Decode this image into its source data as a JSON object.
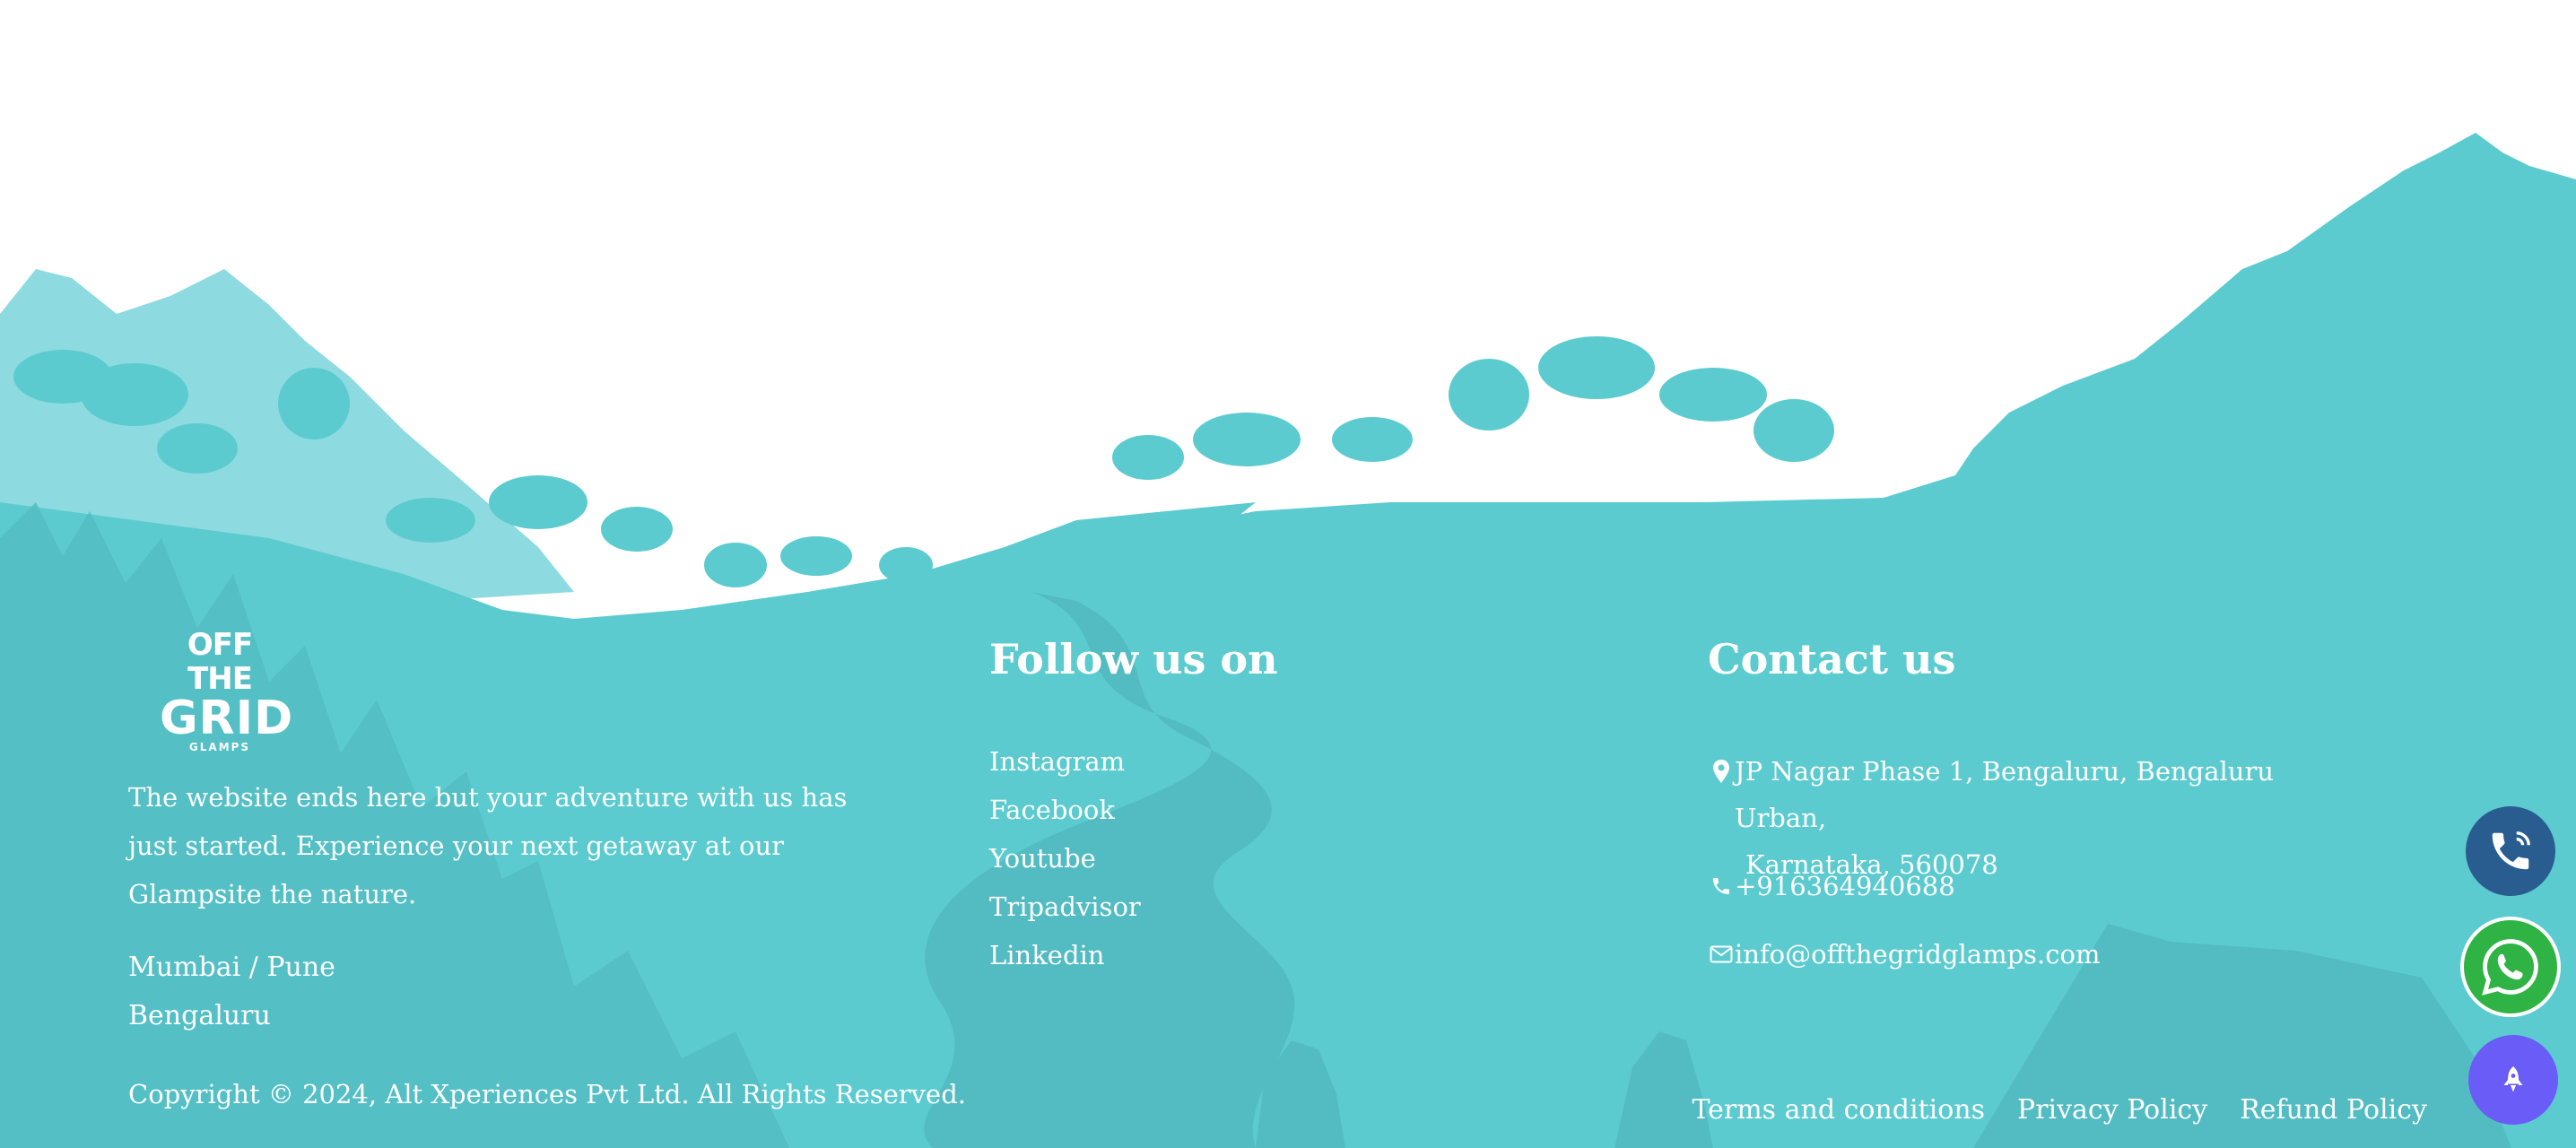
{
  "brand": {
    "logo_line1": "OFF THE",
    "logo_line2": "GRID",
    "logo_line3": "GLAMPS"
  },
  "about": {
    "text": "The website ends here but your adventure with us has just started. Experience your next getaway at our Glampsite the nature."
  },
  "locations": [
    "Mumbai / Pune",
    "Bengaluru"
  ],
  "follow": {
    "title": "Follow us on",
    "links": [
      "Instagram",
      "Facebook",
      "Youtube",
      "Tripadvisor",
      "Linkedin"
    ]
  },
  "contact": {
    "title": "Contact us",
    "address_line1": "JP Nagar Phase 1, Bengaluru, Bengaluru Urban,",
    "address_line2": "Karnataka, 560078",
    "phone": "+916364940688",
    "email": "info@offthegridglamps.com"
  },
  "copyright": "Copyright © 2024, Alt Xperiences Pvt Ltd. All Rights Reserved.",
  "policies": [
    "Terms and conditions",
    "Privacy Policy",
    "Refund Policy"
  ],
  "floating_buttons": [
    {
      "name": "phone-call",
      "icon": "phone-icon",
      "color": "#2a5d8f"
    },
    {
      "name": "whatsapp",
      "icon": "whatsapp-icon",
      "color": "#2fb344"
    },
    {
      "name": "scroll-top",
      "icon": "rocket-icon",
      "color": "#6a5cf6"
    }
  ],
  "colors": {
    "footer_bg": "#5ccbd0",
    "hill_light": "#8ddbe0",
    "silhouette_dark": "#4fb6bd",
    "text": "#ffffff"
  }
}
